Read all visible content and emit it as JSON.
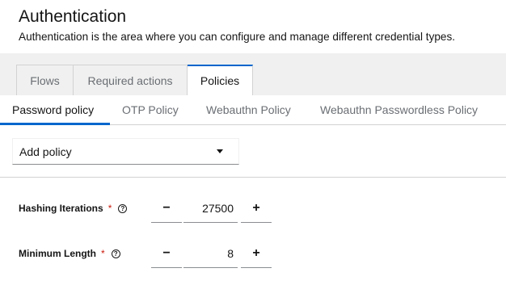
{
  "header": {
    "title": "Authentication",
    "description": "Authentication is the area where you can configure and manage different credential types."
  },
  "tabs": [
    {
      "label": "Flows",
      "active": false
    },
    {
      "label": "Required actions",
      "active": false
    },
    {
      "label": "Policies",
      "active": true
    }
  ],
  "subtabs": [
    {
      "label": "Password policy",
      "active": true
    },
    {
      "label": "OTP Policy",
      "active": false
    },
    {
      "label": "Webauthn Policy",
      "active": false
    },
    {
      "label": "Webauthn Passwordless Policy",
      "active": false
    }
  ],
  "add_policy": {
    "label": "Add policy",
    "icon": "caret-down-icon"
  },
  "fields": [
    {
      "label": "Hashing Iterations",
      "required_mark": "*",
      "help_icon": "?",
      "value": "27500",
      "minus": "−",
      "plus": "+"
    },
    {
      "label": "Minimum Length",
      "required_mark": "*",
      "help_icon": "?",
      "value": "8",
      "minus": "−",
      "plus": "+"
    }
  ],
  "colors": {
    "accent": "#0066cc",
    "required": "#c9190b",
    "tab_bg": "#f0f0f0",
    "border": "#d2d2d2"
  }
}
